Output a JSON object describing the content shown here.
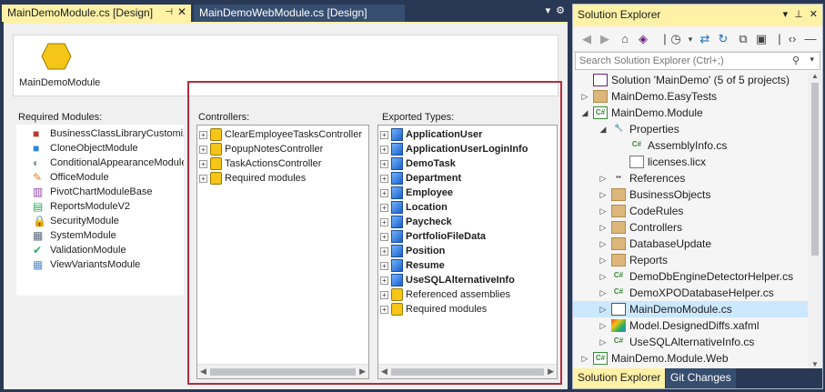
{
  "doc_tabs": [
    {
      "label": "MainDemoModule.cs [Design]"
    },
    {
      "label": "MainDemoWebModule.cs [Design]"
    }
  ],
  "designer": {
    "module_name": "MainDemoModule",
    "required_modules_label": "Required Modules:",
    "required_modules": [
      "BusinessClassLibraryCustomiza",
      "CloneObjectModule",
      "ConditionalAppearanceModule",
      "OfficeModule",
      "PivotChartModuleBase",
      "ReportsModuleV2",
      "SecurityModule",
      "SystemModule",
      "ValidationModule",
      "ViewVariantsModule"
    ],
    "controllers_label": "Controllers:",
    "controllers": [
      "ClearEmployeeTasksController",
      "PopupNotesController",
      "TaskActionsController",
      "Required modules"
    ],
    "exported_types_label": "Exported Types:",
    "exported_types": [
      "ApplicationUser",
      "ApplicationUserLoginInfo",
      "DemoTask",
      "Department",
      "Employee",
      "Location",
      "Paycheck",
      "PortfolioFileData",
      "Position",
      "Resume",
      "UseSQLAlternativeInfo"
    ],
    "exported_extra": [
      "Referenced assemblies",
      "Required modules"
    ]
  },
  "solution_explorer": {
    "title": "Solution Explorer",
    "search_placeholder": "Search Solution Explorer (Ctrl+;)",
    "tree": [
      {
        "label": "Solution 'MainDemo' (5 of 5 projects)",
        "icon": "solution-icon",
        "level": 0,
        "arrow": ""
      },
      {
        "label": "MainDemo.EasyTests",
        "icon": "folder-icon",
        "level": 0,
        "arrow": "▷"
      },
      {
        "label": "MainDemo.Module",
        "icon": "csharp-project-icon",
        "level": 0,
        "arrow": "◢"
      },
      {
        "label": "Properties",
        "icon": "wrench-icon",
        "level": 1,
        "arrow": "◢"
      },
      {
        "label": "AssemblyInfo.cs",
        "icon": "csharp-file-icon",
        "level": 2,
        "arrow": ""
      },
      {
        "label": "licenses.licx",
        "icon": "file-icon",
        "level": 2,
        "arrow": ""
      },
      {
        "label": "References",
        "icon": "references-icon",
        "level": 1,
        "arrow": "▷"
      },
      {
        "label": "BusinessObjects",
        "icon": "folder-icon",
        "level": 1,
        "arrow": "▷"
      },
      {
        "label": "CodeRules",
        "icon": "folder-icon",
        "level": 1,
        "arrow": "▷"
      },
      {
        "label": "Controllers",
        "icon": "folder-icon",
        "level": 1,
        "arrow": "▷"
      },
      {
        "label": "DatabaseUpdate",
        "icon": "folder-icon",
        "level": 1,
        "arrow": "▷"
      },
      {
        "label": "Reports",
        "icon": "folder-icon",
        "level": 1,
        "arrow": "▷"
      },
      {
        "label": "DemoDbEngineDetectorHelper.cs",
        "icon": "csharp-file-icon",
        "level": 1,
        "arrow": "▷"
      },
      {
        "label": "DemoXPODatabaseHelper.cs",
        "icon": "csharp-file-icon",
        "level": 1,
        "arrow": "▷"
      },
      {
        "label": "MainDemoModule.cs",
        "icon": "module-file-icon",
        "level": 1,
        "arrow": "▷",
        "selected": true
      },
      {
        "label": "Model.DesignedDiffs.xafml",
        "icon": "xafml-icon",
        "level": 1,
        "arrow": "▷"
      },
      {
        "label": "UseSQLAlternativeInfo.cs",
        "icon": "csharp-file-icon",
        "level": 1,
        "arrow": "▷"
      },
      {
        "label": "MainDemo.Module.Web",
        "icon": "csharp-project-icon",
        "level": 0,
        "arrow": "▷"
      }
    ],
    "tabs": [
      {
        "label": "Solution Explorer"
      },
      {
        "label": "Git Changes"
      }
    ]
  }
}
